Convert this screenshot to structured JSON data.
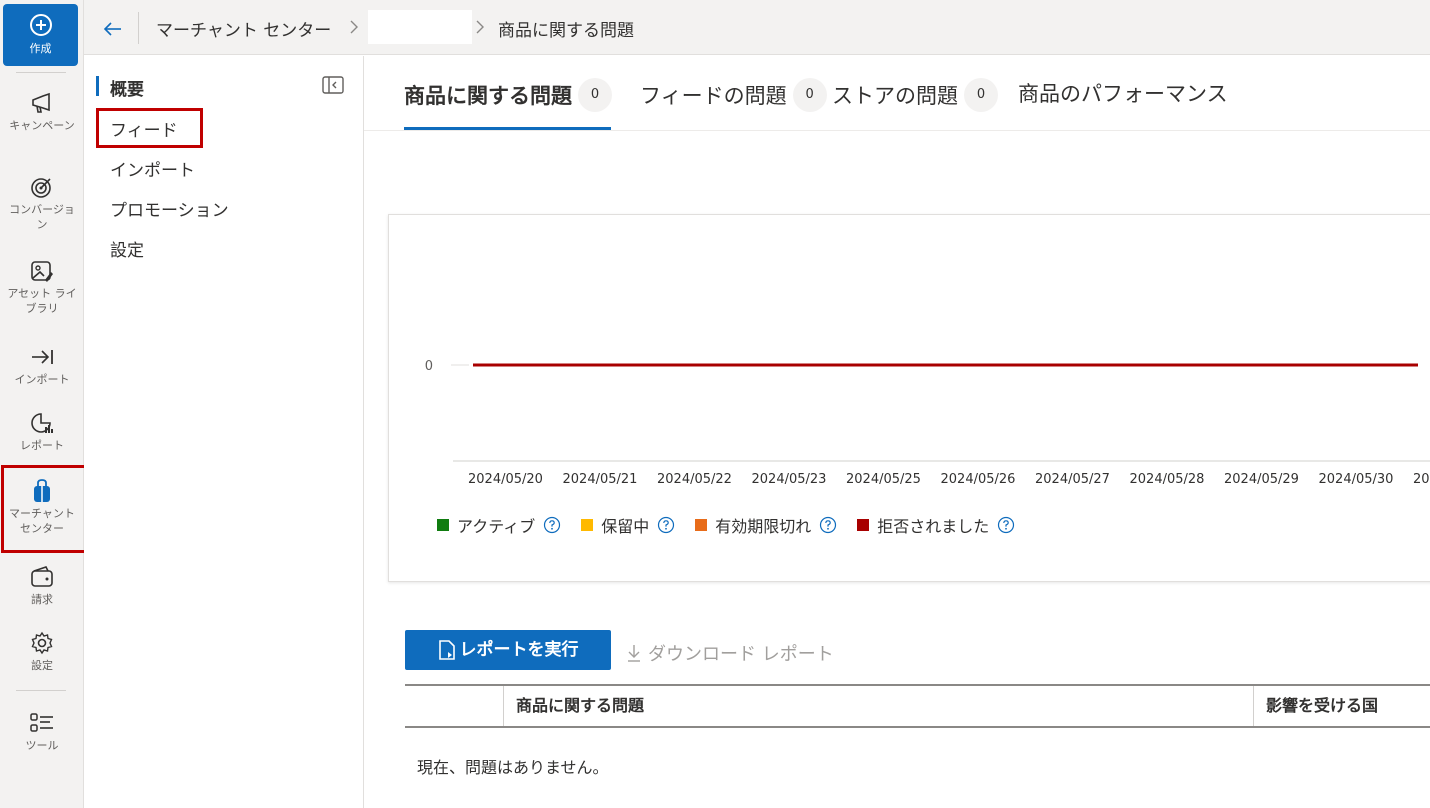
{
  "rail": {
    "create_label": "作成",
    "items": [
      {
        "label": "キャンペーン",
        "icon": "megaphone-icon"
      },
      {
        "label": "コンバージョン",
        "icon": "target-icon"
      },
      {
        "label": "アセット ライブラリ",
        "icon": "image-library-icon"
      },
      {
        "label": "インポート",
        "icon": "import-arrow-icon"
      },
      {
        "label": "レポート",
        "icon": "pie-chart-icon"
      },
      {
        "label": "マーチャント センター",
        "icon": "shopping-bag-icon"
      },
      {
        "label": "請求",
        "icon": "wallet-icon"
      },
      {
        "label": "設定",
        "icon": "gear-icon"
      },
      {
        "label": "ツール",
        "icon": "tools-list-icon"
      }
    ]
  },
  "breadcrumb": {
    "items": [
      "マーチャント センター",
      "",
      "商品に関する問題"
    ]
  },
  "subnav": {
    "items": [
      {
        "label": "概要",
        "active": true
      },
      {
        "label": "フィード"
      },
      {
        "label": "インポート"
      },
      {
        "label": "プロモーション"
      },
      {
        "label": "設定"
      }
    ]
  },
  "tabs": [
    {
      "label": "商品に関する問題",
      "count": "0",
      "active": true
    },
    {
      "label": "フィードの問題",
      "count": "0"
    },
    {
      "label": "ストアの問題",
      "count": "0"
    },
    {
      "label": "商品のパフォーマンス"
    }
  ],
  "chart_data": {
    "type": "line",
    "x": [
      "2024/05/20",
      "2024/05/21",
      "2024/05/22",
      "2024/05/23",
      "2024/05/25",
      "2024/05/26",
      "2024/05/27",
      "2024/05/28",
      "2024/05/29",
      "2024/05/30",
      "20"
    ],
    "y_ticks": [
      "0"
    ],
    "series": [
      {
        "name": "アクティブ",
        "color": "#107c10",
        "values": [
          0,
          0,
          0,
          0,
          0,
          0,
          0,
          0,
          0,
          0,
          0
        ]
      },
      {
        "name": "保留中",
        "color": "#ffb900",
        "values": [
          0,
          0,
          0,
          0,
          0,
          0,
          0,
          0,
          0,
          0,
          0
        ]
      },
      {
        "name": "有効期限切れ",
        "color": "#e86c1a",
        "values": [
          0,
          0,
          0,
          0,
          0,
          0,
          0,
          0,
          0,
          0,
          0
        ]
      },
      {
        "name": "拒否されました",
        "color": "#a80000",
        "values": [
          0,
          0,
          0,
          0,
          0,
          0,
          0,
          0,
          0,
          0,
          0
        ]
      }
    ],
    "legend_position": "bottom-left"
  },
  "actions": {
    "run_report": "レポートを実行",
    "download_report": "ダウンロード レポート"
  },
  "table": {
    "columns": [
      "",
      "商品に関する問題",
      "影響を受ける国"
    ],
    "empty_message": "現在、問題はありません。"
  }
}
